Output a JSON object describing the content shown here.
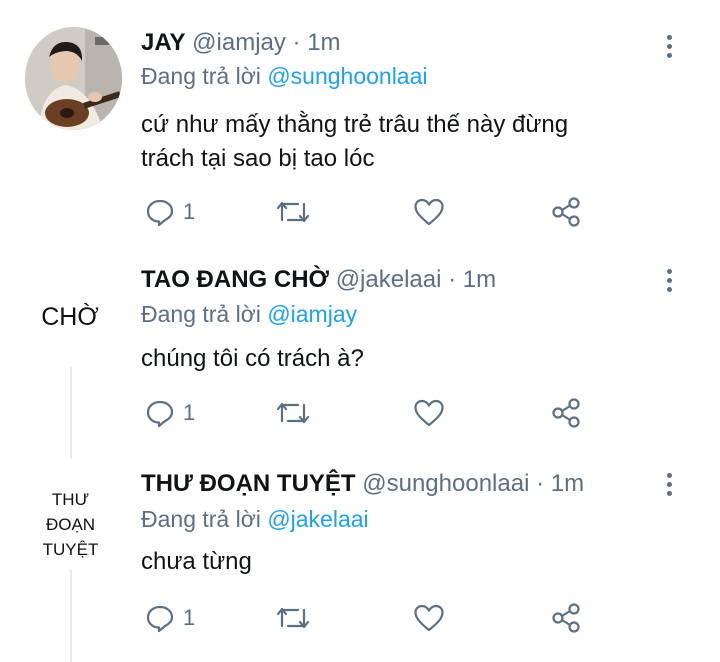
{
  "tweets": [
    {
      "name": "JAY",
      "handle": "@iamjay",
      "time": "· 1m",
      "reply_prefix": "Đang trả lời",
      "reply_to": "@sunghoonlaai",
      "text_lines": [
        "cứ như mấy thằng trẻ trâu thế này đừng",
        "trách tại sao bị tao lóc"
      ],
      "reply_count": "1",
      "avatar": "photo"
    },
    {
      "name": "TAO ĐANG CHỜ",
      "handle": "@jakelaai",
      "time": "· 1m",
      "reply_prefix": "Đang trả lời",
      "reply_to": "@iamjay",
      "text_lines": [
        "chúng tôi có trách à?"
      ],
      "reply_count": "1",
      "avatar_text": [
        "CHỜ"
      ]
    },
    {
      "name": "THƯ ĐOẠN TUYỆT",
      "handle": "@sunghoonlaai",
      "time": "· 1m",
      "reply_prefix": "Đang trả lời",
      "reply_to": "@jakelaai",
      "text_lines": [
        "chưa từng"
      ],
      "reply_count": "1",
      "avatar_text": [
        "THƯ",
        "ĐOẠN",
        "TUYỆT"
      ]
    }
  ],
  "icons": {
    "reply": "reply-icon",
    "retweet": "retweet-icon",
    "like": "heart-icon",
    "share": "share-icon",
    "more": "more-options-icon"
  },
  "colors": {
    "text": "#0f1419",
    "secondary": "#5b7083",
    "mention": "#1da1f2",
    "thread_line": "#e6ecf0"
  }
}
